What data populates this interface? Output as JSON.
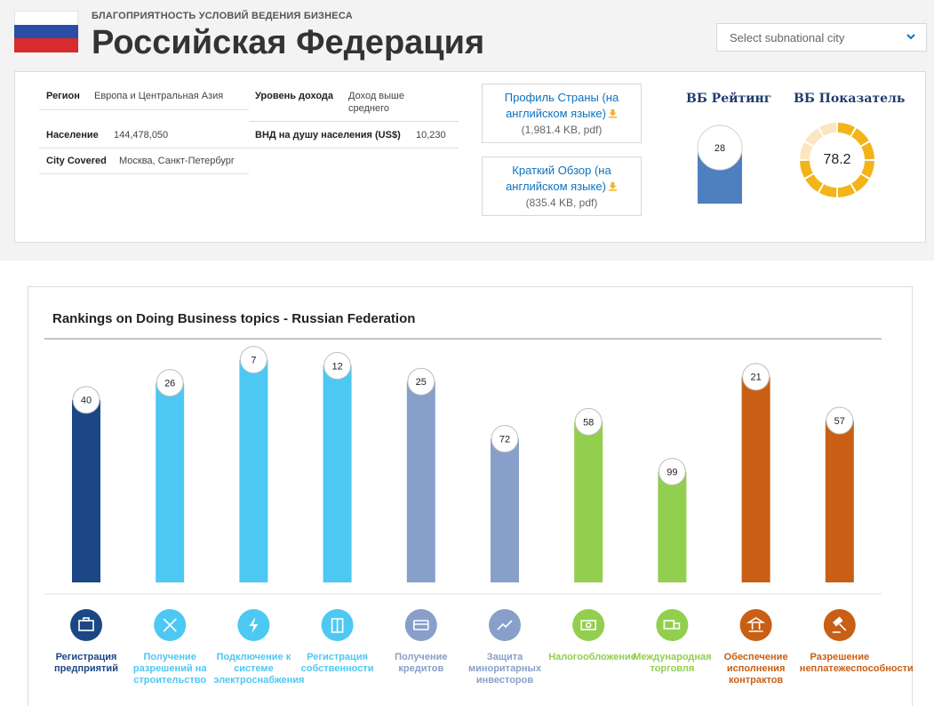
{
  "header": {
    "overline": "БЛАГОПРИЯТНОСТЬ УСЛОВИЙ ВЕДЕНИЯ БИЗНЕСА",
    "title": "Российская Федерация",
    "city_select_placeholder": "Select subnational city"
  },
  "info": {
    "region_label": "Регион",
    "region_value": "Европа и Центральная Азия",
    "income_label": "Уровень дохода",
    "income_value": "Доход выше среднего",
    "population_label": "Население",
    "population_value": "144,478,050",
    "gni_label": "ВНД на душу населения (US$)",
    "gni_value": "10,230",
    "city_label": "City Covered",
    "city_value": "Москва, Санкт-Петербург"
  },
  "downloads": [
    {
      "link": "Профиль Страны (на английском языке)",
      "size": "(1,981.4 KB, pdf)"
    },
    {
      "link": "Краткий Обзор (на английском языке)",
      "size": "(835.4 KB, pdf)"
    }
  ],
  "kpi": {
    "rank_title": "ВБ Рейтинг",
    "rank_value": "28",
    "score_title": "ВБ Показатель",
    "score_value": "78.2",
    "score_fraction": 0.782
  },
  "chart_data": {
    "type": "bar",
    "title": "Rankings on Doing Business topics - Russian Federation",
    "ylim": [
      0,
      190
    ],
    "inverted": true,
    "categories": [
      "Регистрация предприятий",
      "Получение разрешений на строительство",
      "Подключение к системе электроснабжения",
      "Регистрация собственности",
      "Получение кредитов",
      "Защита миноритарных инвесторов",
      "Налогообложение",
      "Международная торговля",
      "Обеспечение исполнения контрактов",
      "Разрешение неплатежеспособности"
    ],
    "values": [
      40,
      26,
      7,
      12,
      25,
      72,
      58,
      99,
      21,
      57
    ],
    "colors": [
      "#1c4785",
      "#4dc8f3",
      "#4dc8f3",
      "#4dc8f3",
      "#889fc9",
      "#889fc9",
      "#92cf4e",
      "#92cf4e",
      "#c85f15",
      "#c85f15"
    ],
    "icons": [
      "briefcase-icon",
      "tools-icon",
      "lightning-icon",
      "building-icon",
      "credit-card-icon",
      "trend-up-icon",
      "money-icon",
      "truck-icon",
      "courthouse-icon",
      "gavel-icon"
    ]
  }
}
